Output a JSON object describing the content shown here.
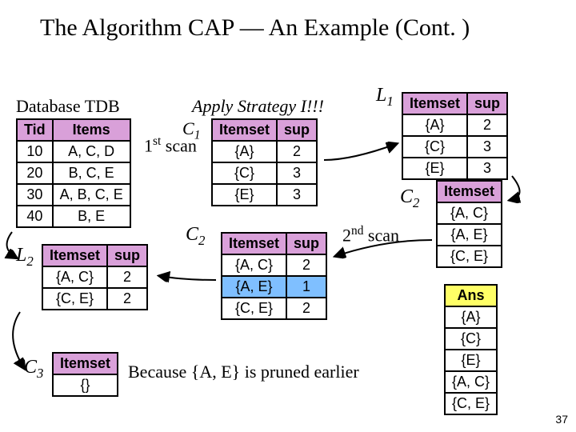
{
  "title": "The Algorithm CAP — An Example (Cont. )",
  "labels": {
    "dbTitle": "Database TDB",
    "applyStrategy": "Apply Strategy I!!!",
    "L1": "L",
    "L1_sub": "1",
    "C1": "C",
    "C1_sub": "1",
    "firstScan": "1",
    "firstScan_sup": "st",
    "firstScan_rest": " scan",
    "C2a": "C",
    "C2a_sub": "2",
    "C2b": "C",
    "C2b_sub": "2",
    "secondScan": "2",
    "secondScan_sup": "nd",
    "secondScan_rest": " scan",
    "L2": "L",
    "L2_sub": "2",
    "C3": "C",
    "C3_sub": "3",
    "prunedNote": "Because {A, E} is pruned earlier"
  },
  "tdb": {
    "h1": "Tid",
    "h2": "Items",
    "r": [
      {
        "tid": "10",
        "items": "A, C, D"
      },
      {
        "tid": "20",
        "items": "B, C, E"
      },
      {
        "tid": "30",
        "items": "A, B, C, E"
      },
      {
        "tid": "40",
        "items": "B, E"
      }
    ]
  },
  "c1": {
    "h1": "Itemset",
    "h2": "sup",
    "r": [
      {
        "i": "{A}",
        "s": "2"
      },
      {
        "i": "{C}",
        "s": "3"
      },
      {
        "i": "{E}",
        "s": "3"
      }
    ]
  },
  "l1": {
    "h1": "Itemset",
    "h2": "sup",
    "r": [
      {
        "i": "{A}",
        "s": "2"
      },
      {
        "i": "{C}",
        "s": "3"
      },
      {
        "i": "{E}",
        "s": "3"
      }
    ]
  },
  "c2_items": {
    "h1": "Itemset",
    "r": [
      "{A, C}",
      "{A, E}",
      "{C, E}"
    ]
  },
  "c2_sup": {
    "h1": "Itemset",
    "h2": "sup",
    "r": [
      {
        "i": "{A, C}",
        "s": "2",
        "hl": false
      },
      {
        "i": "{A, E}",
        "s": "1",
        "hl": true
      },
      {
        "i": "{C, E}",
        "s": "2",
        "hl": false
      }
    ]
  },
  "l2": {
    "h1": "Itemset",
    "h2": "sup",
    "r": [
      {
        "i": "{A, C}",
        "s": "2"
      },
      {
        "i": "{C, E}",
        "s": "2"
      }
    ]
  },
  "c3": {
    "h1": "Itemset",
    "r": [
      "{}"
    ]
  },
  "ans": {
    "h1": "Ans",
    "r": [
      "{A}",
      "{C}",
      "{E}",
      "{A, C}",
      "{C, E}"
    ]
  },
  "pageNum": "37"
}
